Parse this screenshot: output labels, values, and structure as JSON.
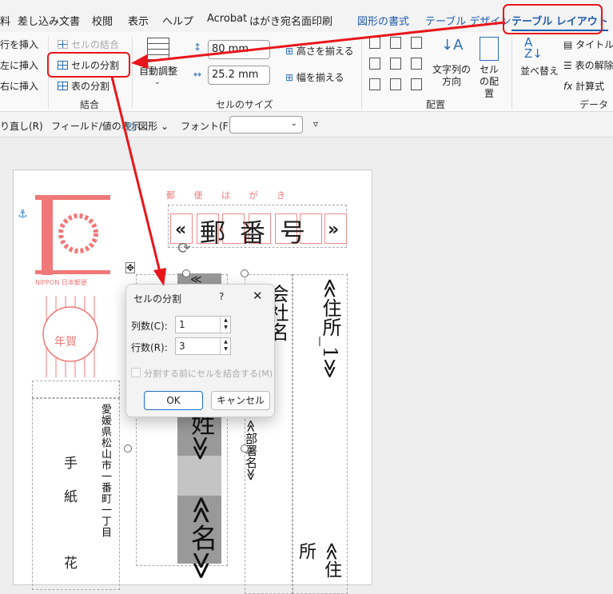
{
  "tabs": [
    "料",
    "差し込み文書",
    "校閲",
    "表示",
    "ヘルプ",
    "Acrobat",
    "はがき宛名面印刷",
    "図形の書式",
    "テーブル デザイン",
    "テーブル レイアウト"
  ],
  "ribbon": {
    "rows_cols": [
      "行を挿入",
      "左に挿入",
      "右に挿入"
    ],
    "merge": {
      "merge_cells": "セルの結合",
      "split_cells": "セルの分割",
      "split_table": "表の分割",
      "label": "結合"
    },
    "cell_size": {
      "autofit": "自動調整",
      "height": "80 mm",
      "width": "25.2 mm",
      "distribute_rows": "高さを揃える",
      "distribute_cols": "幅を揃える",
      "label": "セルのサイズ"
    },
    "alignment": {
      "text_direction": "文字列の方向",
      "cell_margins": "セルの配置",
      "label": "配置"
    },
    "data": {
      "sort": "並べ替え",
      "header_rows": "タイトル行",
      "convert": "表の解除",
      "formula": "計算式",
      "label": "データ"
    }
  },
  "toolbar": {
    "redo": "り直し(R)",
    "field_display": "フィールド/値の表示",
    "shape": "図形",
    "font_label": "フォント(F):",
    "font_value": ""
  },
  "document": {
    "postcard_title": "郵 便 は が き",
    "postal_code": [
      "«",
      "郵",
      "番",
      "号",
      "»"
    ],
    "address1": "≪住所_1≫",
    "address2": "≪住所",
    "department": "≪部署名≫",
    "name_top": "≪",
    "name_part1": "姓≫",
    "name_part2": "≪名≫",
    "company_partial": "会社名",
    "sender_address": "愛媛県松山市一番町一丁目",
    "sender_name": [
      "手",
      "紙",
      "花"
    ],
    "stamp_text": "NIPPON 日本郵便",
    "stamp_nenga": "年賀"
  },
  "dialog": {
    "title": "セルの分割",
    "help": "?",
    "cols_label": "列数(C):",
    "cols_value": "1",
    "rows_label": "行数(R):",
    "rows_value": "3",
    "merge_before": "分割する前にセルを結合する(M)",
    "merge_before_checked": false,
    "ok": "OK",
    "cancel": "キャンセル"
  },
  "colors": {
    "annotation": "#e8161b",
    "accent": "#1f5bad",
    "stamp": "#f07878"
  }
}
